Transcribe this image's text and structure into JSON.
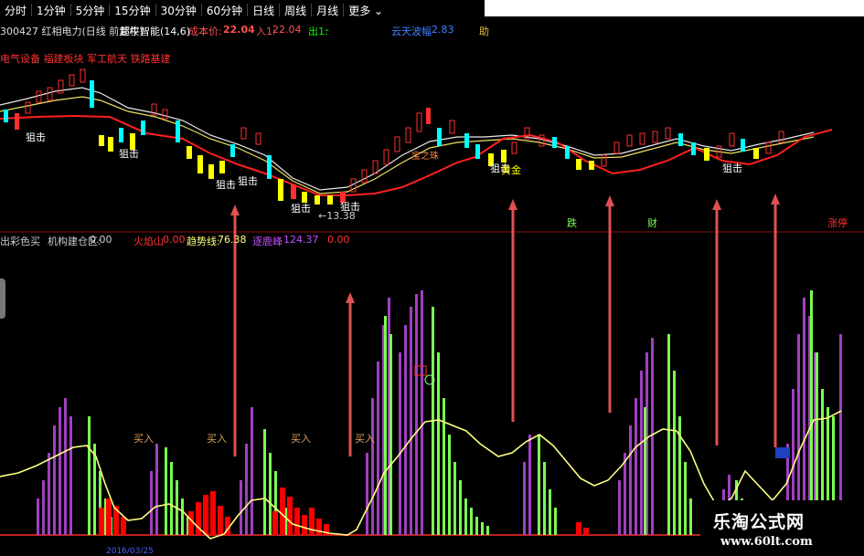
{
  "toolbar": {
    "items": [
      "分时",
      "1分钟",
      "5分钟",
      "15分钟",
      "30分钟",
      "60分钟",
      "日线",
      "周线",
      "月线",
      "更多"
    ],
    "active": "日线",
    "dropdown_icon": "chevron-down-icon"
  },
  "info": {
    "stock": "300427 红相电力(日线 前复权)",
    "indicator": "超牛智能(14,6)",
    "cost_label": "成本价:",
    "cost_value": "22.04",
    "buy_label": "入1:",
    "buy_value": "22.04",
    "out_label": "出1:",
    "out_value": "-",
    "right_label": "云天波幅",
    "right_value": "2.83",
    "far_right": "助"
  },
  "concepts": "电气设备 福建板块 军工航天 铁路基建",
  "annotations": {
    "ambush": "狙击",
    "low_price": "13.38",
    "stars": "宝之珠",
    "gold": "黄金",
    "down": "跌",
    "wealth": "财",
    "limit_up": "涨停"
  },
  "indicator_row": {
    "name": "出彩色买",
    "sub": "机构建仓区:",
    "sub_value": "0.00",
    "volcano_label": "火焰山",
    "volcano_value": "0.00",
    "trend_label": "趋势线:",
    "trend_value": "76.38",
    "spike_label": "逐鹿峰",
    "spike_value": "124.37",
    "last_value": "0.00"
  },
  "buy_labels": [
    "买入",
    "买入",
    "买入",
    "买入"
  ],
  "date_stub": "2016/03/25",
  "brand": {
    "name": "乐淘公式网",
    "url": "www.60lt.com"
  },
  "colors": {
    "up": "#ff3030",
    "down": "#00ffff",
    "green_bar": "#7cff50",
    "purple_bar": "#a040c0",
    "red_block": "#ff0000",
    "trend": "#ffff80",
    "arrow": "#e05050"
  }
}
